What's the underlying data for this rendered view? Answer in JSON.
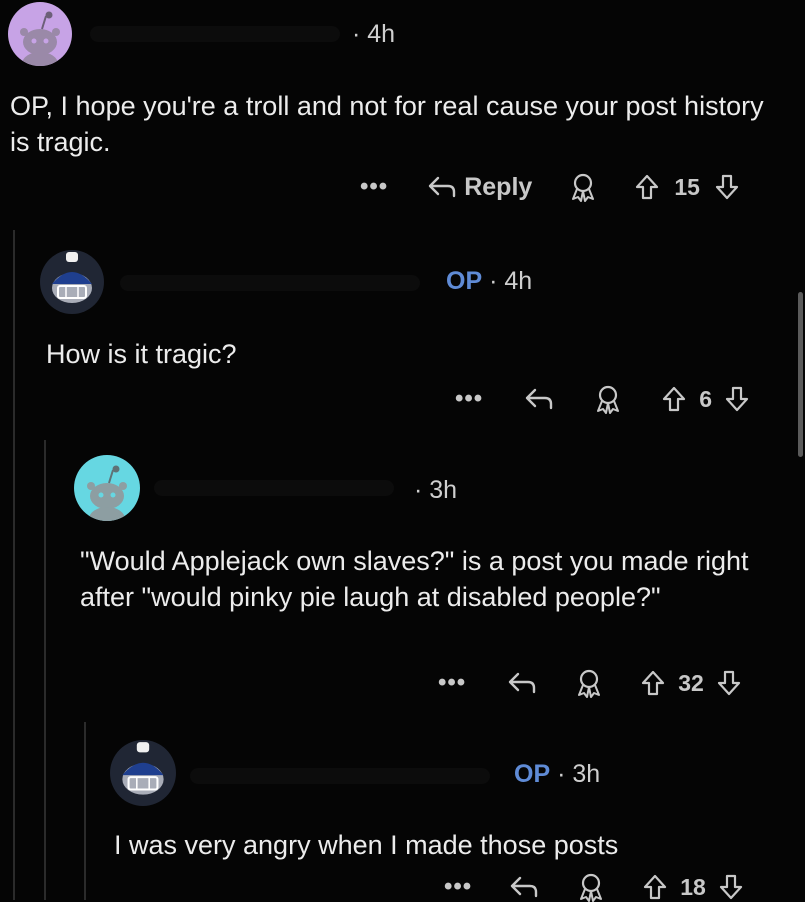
{
  "comments": [
    {
      "author_flag": "",
      "time": "4h",
      "text": "OP, I hope you're a troll and not for real cause your post history is tragic.",
      "reply_label": "Reply",
      "score": "15"
    },
    {
      "author_flag": "OP",
      "time": "4h",
      "text": "How is it tragic?",
      "score": "6"
    },
    {
      "author_flag": "",
      "time": "3h",
      "text": "\"Would Applejack own slaves?\" is a post you made right after \"would pinky pie laugh at disabled people?\"",
      "score": "32"
    },
    {
      "author_flag": "OP",
      "time": "3h",
      "text": "I was very angry when I made those posts",
      "score": "18"
    }
  ],
  "ui": {
    "more_label": "•••",
    "separator": "·"
  },
  "colors": {
    "background": "#050505",
    "op_flag": "#5f8bd6",
    "avatar_purple": "#c7a3e6",
    "avatar_teal": "#66d7e2"
  },
  "icons": [
    "snoo-avatar",
    "more-icon",
    "reply-icon",
    "award-icon",
    "upvote-icon",
    "downvote-icon"
  ]
}
